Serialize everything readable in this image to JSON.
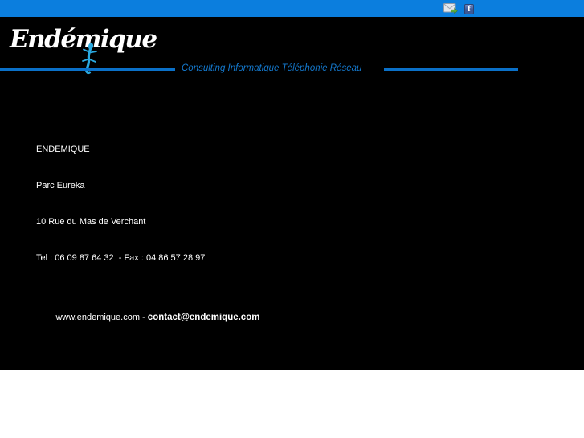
{
  "topbar": {
    "facebook_glyph": "f"
  },
  "header": {
    "logo_text": "Endémique",
    "tagline": "Consulting Informatique Téléphonie Réseau"
  },
  "contact": {
    "company": "ENDEMIQUE",
    "address_line1": "Parc Eureka",
    "address_line2": "10 Rue du Mas de Verchant",
    "phone_line": "Tel : 06 09 87 64 32  - Fax : 04 86 57 28 97",
    "website": "www.endemique.com",
    "separator": " - ",
    "email": "contact@endemique.com"
  },
  "colors": {
    "topbar_blue": "#0b7ede",
    "divider_blue": "#0a70c8",
    "tagline_blue": "#1478cc",
    "logo_blue": "#2aa9e0",
    "facebook_blue": "#3b5998",
    "background_black": "#000000",
    "text_white": "#ffffff"
  }
}
